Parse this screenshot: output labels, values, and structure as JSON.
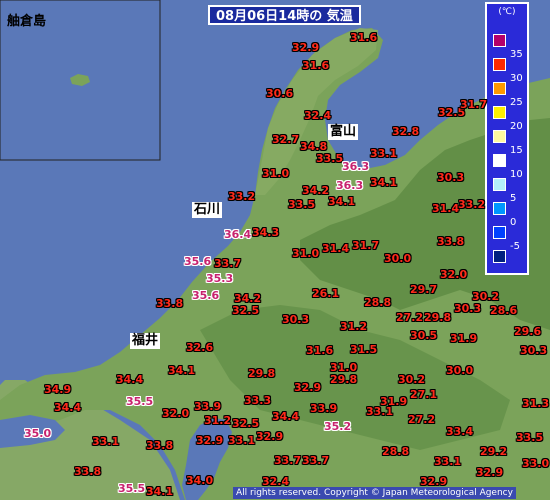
{
  "title": "08月06日14時の 気温",
  "inset": {
    "label": "舳倉島"
  },
  "legend": {
    "unit": "(℃)",
    "items": [
      {
        "color": "#b4006a",
        "label": "35"
      },
      {
        "color": "#ff2800",
        "label": "30"
      },
      {
        "color": "#ff9900",
        "label": "25"
      },
      {
        "color": "#fff000",
        "label": "20"
      },
      {
        "color": "#fffaa0",
        "label": "15"
      },
      {
        "color": "#ffffff",
        "label": "10"
      },
      {
        "color": "#b4f0fa",
        "label": "5"
      },
      {
        "color": "#0096ff",
        "label": "0"
      },
      {
        "color": "#0041ff",
        "label": "-5"
      },
      {
        "color": "#002080",
        "label": ""
      }
    ]
  },
  "prefectures": [
    {
      "name": "富山"
    },
    {
      "name": "石川"
    },
    {
      "name": "福井"
    }
  ],
  "temperatures": [
    "32.9",
    "31.6",
    "31.6",
    "30.6",
    "32.4",
    "32.7",
    "34.8",
    "32.8",
    "32.5",
    "31.7",
    "33.5",
    "36.3",
    "33.1",
    "31.0",
    "36.3",
    "34.1",
    "30.3",
    "33.2",
    "34.2",
    "33.5",
    "34.1",
    "31.4",
    "33.2",
    "36.4",
    "34.3",
    "31.0",
    "31.4",
    "31.7",
    "30.0",
    "33.8",
    "35.6",
    "33.7",
    "32.0",
    "35.3",
    "29.7",
    "35.6",
    "34.2",
    "26.1",
    "28.8",
    "30.2",
    "33.8",
    "32.5",
    "27.2",
    "29.8",
    "30.3",
    "28.6",
    "30.3",
    "31.2",
    "30.5",
    "31.9",
    "29.6",
    "32.6",
    "31.6",
    "31.5",
    "34.1",
    "29.8",
    "31.0",
    "30.3",
    "30.0",
    "34.4",
    "29.8",
    "30.2",
    "34.9",
    "33.3",
    "32.9",
    "31.9",
    "27.1",
    "35.5",
    "32.0",
    "33.9",
    "33.1",
    "34.4",
    "33.9",
    "31.3",
    "34.4",
    "31.2",
    "32.5",
    "27.2",
    "35.0",
    "33.1",
    "33.4",
    "33.8",
    "32.9",
    "35.2",
    "33.5",
    "32.9",
    "33.1",
    "33.1",
    "33.8",
    "33.7",
    "28.8",
    "29.2",
    "35.5",
    "34.1",
    "34.0",
    "32.4",
    "32.9",
    "33.7",
    "33.0",
    "32.9"
  ],
  "copyright": "All rights reserved. Copyright © Japan Meteorological Agency",
  "colors": {
    "sea": "#5a78b8",
    "land": "#7ba35a",
    "mountain": "#5f8c44",
    "lake": "#5a78b8"
  }
}
